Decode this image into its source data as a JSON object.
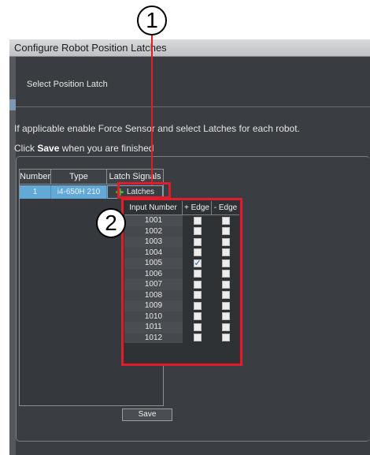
{
  "callouts": {
    "first": "1",
    "second": "2"
  },
  "window": {
    "title": "Configure Robot Position Latches"
  },
  "section": {
    "title": "Select Position Latch"
  },
  "instructions": {
    "line1": "If applicable enable Force Sensor and select Latches for each robot.",
    "line2_prefix": "Click ",
    "line2_bold": "Save",
    "line2_suffix": " when you are finished"
  },
  "robot_table": {
    "headers": [
      "Number",
      "Type",
      "Latch Signals"
    ],
    "rows": [
      {
        "number": "1",
        "type": "i4-650H 210",
        "latch_label": "Latches",
        "selected": true
      }
    ]
  },
  "latch_popup": {
    "headers": [
      "Input Number",
      "+ Edge",
      "- Edge"
    ],
    "rows": [
      {
        "input": "1001",
        "plus": false,
        "minus": false
      },
      {
        "input": "1002",
        "plus": false,
        "minus": false
      },
      {
        "input": "1003",
        "plus": false,
        "minus": false
      },
      {
        "input": "1004",
        "plus": false,
        "minus": false
      },
      {
        "input": "1005",
        "plus": true,
        "minus": false
      },
      {
        "input": "1006",
        "plus": false,
        "minus": false
      },
      {
        "input": "1007",
        "plus": false,
        "minus": false
      },
      {
        "input": "1008",
        "plus": false,
        "minus": false
      },
      {
        "input": "1009",
        "plus": false,
        "minus": false
      },
      {
        "input": "1010",
        "plus": false,
        "minus": false
      },
      {
        "input": "1011",
        "plus": false,
        "minus": false
      },
      {
        "input": "1012",
        "plus": false,
        "minus": false
      }
    ]
  },
  "buttons": {
    "save_label": "Save"
  },
  "colors": {
    "highlight_red": "#e21d2b",
    "selected_row": "#62a9d8",
    "window_bg": "#3a3d42"
  },
  "icons": {
    "latch_add": "plus-icon",
    "checkbox_checked": "check-icon"
  }
}
